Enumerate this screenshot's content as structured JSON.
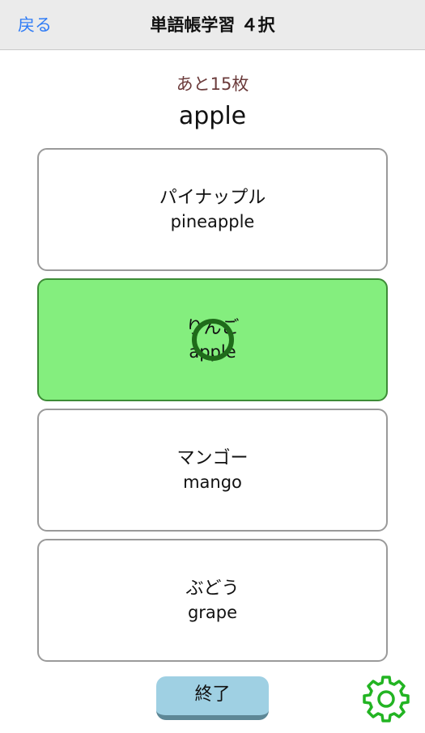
{
  "navbar": {
    "back_label": "戻る",
    "title": "単語帳学習 ４択"
  },
  "quiz": {
    "remaining": "あと15枚",
    "question": "apple",
    "choices": [
      {
        "ja": "パイナップル",
        "en": "pineapple",
        "state": "normal"
      },
      {
        "ja": "りんご",
        "en": "apple",
        "state": "correct"
      },
      {
        "ja": "マンゴー",
        "en": "mango",
        "state": "normal"
      },
      {
        "ja": "ぶどう",
        "en": "grape",
        "state": "normal"
      }
    ]
  },
  "footer": {
    "finish_label": "終了",
    "settings_icon": "gear-icon"
  },
  "colors": {
    "nav_link": "#2f7cf6",
    "correct_fill": "#84ee7e",
    "correct_mark": "#1f6b1a",
    "finish_button": "#9fd0e3",
    "settings_icon": "#22b422"
  }
}
